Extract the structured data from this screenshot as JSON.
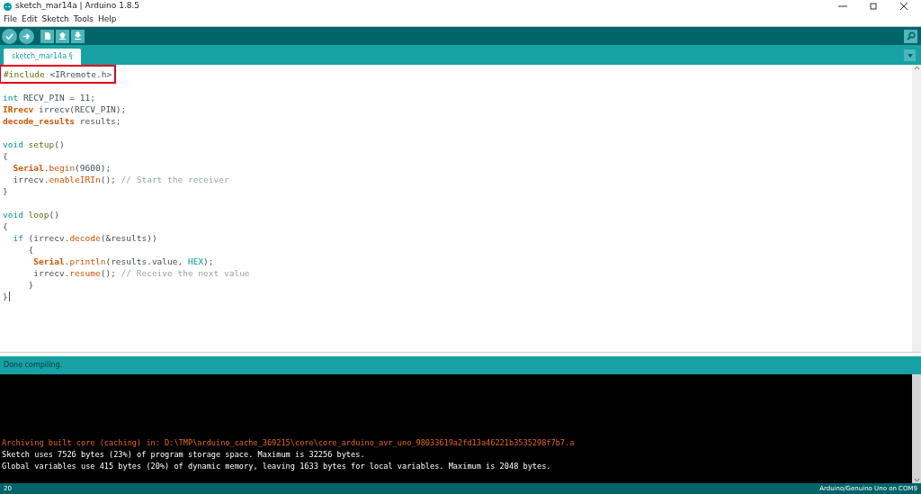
{
  "window": {
    "title": "sketch_mar14a | Arduino 1.8.5"
  },
  "menu": [
    "File",
    "Edit",
    "Sketch",
    "Tools",
    "Help"
  ],
  "tabs": [
    {
      "label": "sketch_mar14a §",
      "selected": true
    }
  ],
  "editor": {
    "lines": [
      {
        "highlighted": true,
        "tokens": [
          {
            "t": "#include",
            "kind": "directive"
          },
          {
            "t": " <IRremote.h>",
            "kind": "plain"
          }
        ]
      },
      {
        "highlighted": false
      },
      {
        "highlighted": false,
        "tokens": [
          {
            "t": "int",
            "kind": "keyword"
          },
          {
            "t": " RECV_PIN = 11;",
            "kind": "plain"
          }
        ]
      },
      {
        "highlighted": false,
        "tokens": [
          {
            "t": "IRrecv",
            "kind": "type"
          },
          {
            "t": " irrecv(RECV_PIN);",
            "kind": "plain"
          }
        ]
      },
      {
        "highlighted": false,
        "tokens": [
          {
            "t": "decode_results",
            "kind": "type"
          },
          {
            "t": " results;",
            "kind": "plain"
          }
        ]
      },
      {
        "highlighted": false
      },
      {
        "highlighted": false,
        "tokens": [
          {
            "t": "void",
            "kind": "keyword"
          },
          {
            "t": " setup",
            "kind": "structure"
          },
          {
            "t": "()",
            "kind": "plain"
          }
        ]
      },
      {
        "highlighted": false,
        "tokens": [
          {
            "t": "{",
            "kind": "plain"
          }
        ]
      },
      {
        "highlighted": false,
        "tokens": [
          {
            "t": "  Serial",
            "kind": "type"
          },
          {
            "t": ".",
            "kind": "plain"
          },
          {
            "t": "begin",
            "kind": "function"
          },
          {
            "t": "(9600);",
            "kind": "plain"
          }
        ]
      },
      {
        "highlighted": false,
        "tokens": [
          {
            "t": "  irrecv.",
            "kind": "plain"
          },
          {
            "t": "enableIRIn",
            "kind": "function"
          },
          {
            "t": "(); ",
            "kind": "plain"
          },
          {
            "t": "// Start the receiver",
            "kind": "comment"
          }
        ]
      },
      {
        "highlighted": false,
        "tokens": [
          {
            "t": "}",
            "kind": "plain"
          }
        ]
      },
      {
        "highlighted": false
      },
      {
        "highlighted": false,
        "tokens": [
          {
            "t": "void",
            "kind": "keyword"
          },
          {
            "t": " loop",
            "kind": "structure"
          },
          {
            "t": "()",
            "kind": "plain"
          }
        ]
      },
      {
        "highlighted": false,
        "tokens": [
          {
            "t": "{",
            "kind": "plain"
          }
        ]
      },
      {
        "highlighted": false,
        "tokens": [
          {
            "t": "  if",
            "kind": "keyword"
          },
          {
            "t": " (irrecv.",
            "kind": "plain"
          },
          {
            "t": "decode",
            "kind": "function"
          },
          {
            "t": "(&results))",
            "kind": "plain"
          }
        ]
      },
      {
        "highlighted": false,
        "tokens": [
          {
            "t": "     {",
            "kind": "plain"
          }
        ]
      },
      {
        "highlighted": false,
        "tokens": [
          {
            "t": "      Serial",
            "kind": "type"
          },
          {
            "t": ".",
            "kind": "plain"
          },
          {
            "t": "println",
            "kind": "function"
          },
          {
            "t": "(results.value, ",
            "kind": "plain"
          },
          {
            "t": "HEX",
            "kind": "keyword"
          },
          {
            "t": ");",
            "kind": "plain"
          }
        ]
      },
      {
        "highlighted": false,
        "tokens": [
          {
            "t": "      irrecv.",
            "kind": "plain"
          },
          {
            "t": "resume",
            "kind": "function"
          },
          {
            "t": "(); ",
            "kind": "plain"
          },
          {
            "t": "// Receive the next value",
            "kind": "comment"
          }
        ]
      },
      {
        "highlighted": false,
        "tokens": [
          {
            "t": "     }",
            "kind": "plain"
          }
        ]
      },
      {
        "highlighted": false,
        "tokens": [
          {
            "t": "}",
            "kind": "plain"
          }
        ]
      }
    ]
  },
  "status": "Done compiling.",
  "console": [
    {
      "kind": "warning",
      "text": "Archiving built core (caching) in: D:\\TMP\\arduino_cache_369215\\core\\core_arduino_avr_uno_98033619a2fd13a46221b3535298f7b7.a"
    },
    {
      "kind": "info",
      "text": "Sketch uses 7526 bytes (23%) of program storage space. Maximum is 32256 bytes."
    },
    {
      "kind": "info",
      "text": "Global variables use 415 bytes (20%) of dynamic memory, leaving 1633 bytes for local variables. Maximum is 2048 bytes."
    }
  ],
  "footer": {
    "line": "20",
    "board": "Arduino/Genuino Uno on COM9"
  }
}
